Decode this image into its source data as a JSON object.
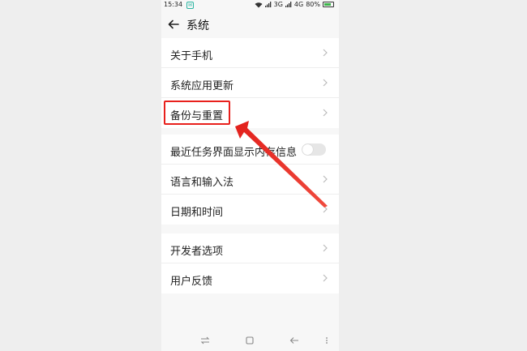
{
  "status_bar": {
    "time": "15:34",
    "app_icon": "app-notification-icon",
    "network_text": "3G",
    "network_text_2": "4G",
    "battery_percent": "80%",
    "battery_level": 0.8
  },
  "header": {
    "back_icon": "back-arrow-icon",
    "title": "系统"
  },
  "groups": [
    {
      "items": [
        {
          "label": "关于手机",
          "type": "link"
        },
        {
          "label": "系统应用更新",
          "type": "link"
        },
        {
          "label": "备份与重置",
          "type": "link",
          "highlighted": true
        }
      ]
    },
    {
      "items": [
        {
          "label": "最近任务界面显示内存信息",
          "type": "toggle",
          "checked": false
        },
        {
          "label": "语言和输入法",
          "type": "link"
        },
        {
          "label": "日期和时间",
          "type": "link"
        }
      ]
    },
    {
      "items": [
        {
          "label": "开发者选项",
          "type": "link"
        },
        {
          "label": "用户反馈",
          "type": "link"
        }
      ]
    }
  ],
  "nav_bar": {
    "icons": [
      "switch-apps-icon",
      "home-square-icon",
      "back-icon",
      "more-dots-icon"
    ]
  },
  "annotation": {
    "highlight_color": "#e8201c"
  }
}
